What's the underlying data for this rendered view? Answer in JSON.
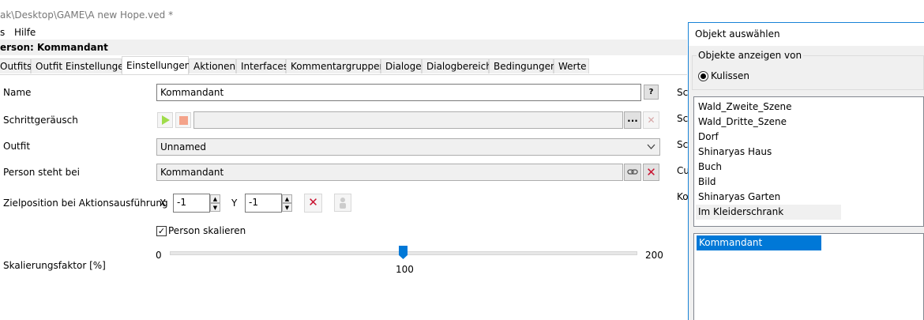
{
  "window": {
    "title": "ak\\Desktop\\GAME\\A new Hope.ved *"
  },
  "menu": {
    "items": [
      "s",
      "Hilfe"
    ]
  },
  "person": {
    "title": "erson: Kommandant"
  },
  "tabs": [
    "Outfits",
    "Outfit Einstellungen",
    "Einstellungen",
    "Aktionen",
    "Interfaces",
    "Kommentargruppen",
    "Dialoge",
    "Dialogbereich",
    "Bedingungen",
    "Werte"
  ],
  "active_tab": "Einstellungen",
  "form": {
    "name_label": "Name",
    "name_value": "Kommandant",
    "help_label": "?",
    "step_label": "Schrittgeräusch",
    "browse_label": "...",
    "outfit_label": "Outfit",
    "outfit_value": "Unnamed",
    "stands_label": "Person steht bei",
    "stands_value": "Kommandant",
    "target_label": "Zielposition bei Aktionsausführung",
    "x_label": "X",
    "x_value": "-1",
    "y_label": "Y",
    "y_value": "-1",
    "scale_check_label": "Person skalieren",
    "scale_checked": true,
    "scale_label": "Skalierungsfaktor [%]",
    "slider_min": "0",
    "slider_max": "200",
    "slider_value": "100"
  },
  "right_labels": [
    "Sch",
    "Sch",
    "Sch",
    "Cu",
    "Ko"
  ],
  "dialog": {
    "title": "Objekt auswählen",
    "group_label": "Objekte anzeigen von",
    "radio_label": "Kulissen",
    "scenes": [
      "Wald_Zweite_Szene",
      "Wald_Dritte_Szene",
      "Dorf",
      "Shinaryas Haus",
      "Buch",
      "Bild",
      "Shinaryas Garten",
      "Im Kleiderschrank"
    ],
    "selected_scene": "Im Kleiderschrank",
    "objects": [
      "Kommandant"
    ],
    "selected_object": "Kommandant"
  },
  "colors": {
    "accent": "#0078d7",
    "delete": "#c8102e",
    "play": "#9fdc4a",
    "stop": "#f4a38a"
  }
}
